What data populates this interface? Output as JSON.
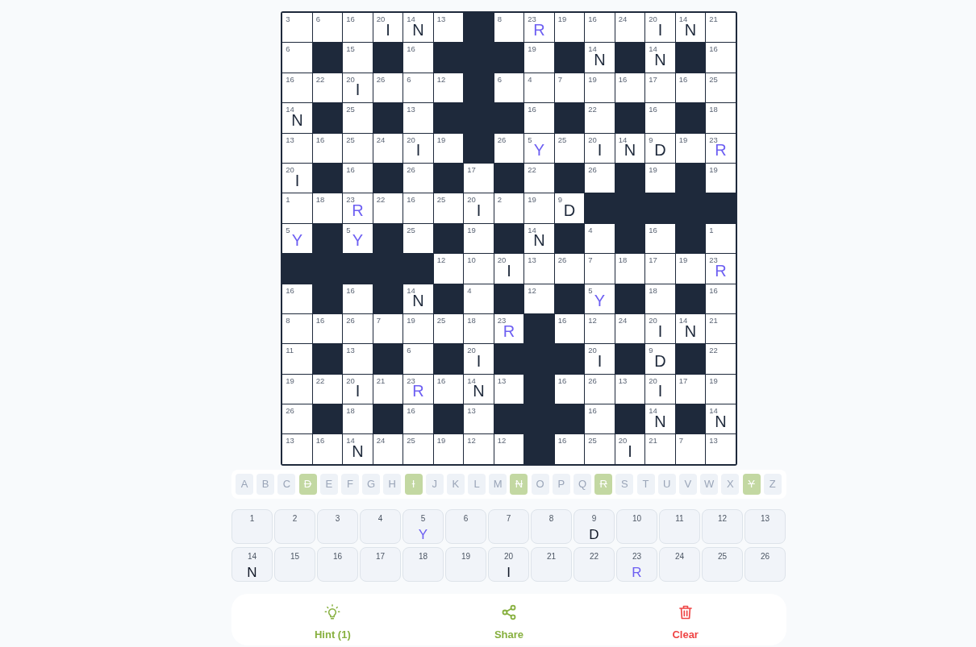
{
  "grid": {
    "rows": [
      [
        {
          "kind": "cell",
          "number": "3"
        },
        {
          "kind": "cell",
          "number": "6"
        },
        {
          "kind": "cell",
          "number": "16"
        },
        {
          "kind": "cell",
          "number": "20",
          "letter": "I",
          "given": false
        },
        {
          "kind": "cell",
          "number": "14",
          "letter": "N",
          "given": false
        },
        {
          "kind": "cell",
          "number": "13"
        },
        {
          "kind": "block"
        },
        {
          "kind": "cell",
          "number": "8"
        },
        {
          "kind": "cell",
          "number": "23",
          "letter": "R",
          "given": true
        },
        {
          "kind": "cell",
          "number": "19"
        },
        {
          "kind": "cell",
          "number": "16"
        },
        {
          "kind": "cell",
          "number": "24"
        },
        {
          "kind": "cell",
          "number": "20",
          "letter": "I",
          "given": false
        },
        {
          "kind": "cell",
          "number": "14",
          "letter": "N",
          "given": false
        },
        {
          "kind": "cell",
          "number": "21"
        }
      ],
      [
        {
          "kind": "cell",
          "number": "6"
        },
        {
          "kind": "block"
        },
        {
          "kind": "cell",
          "number": "15"
        },
        {
          "kind": "block"
        },
        {
          "kind": "cell",
          "number": "16"
        },
        {
          "kind": "block"
        },
        {
          "kind": "block"
        },
        {
          "kind": "block"
        },
        {
          "kind": "cell",
          "number": "19"
        },
        {
          "kind": "block"
        },
        {
          "kind": "cell",
          "number": "14",
          "letter": "N",
          "given": false
        },
        {
          "kind": "block"
        },
        {
          "kind": "cell",
          "number": "14",
          "letter": "N",
          "given": false
        },
        {
          "kind": "block"
        },
        {
          "kind": "cell",
          "number": "16"
        }
      ],
      [
        {
          "kind": "cell",
          "number": "16"
        },
        {
          "kind": "cell",
          "number": "22"
        },
        {
          "kind": "cell",
          "number": "20",
          "letter": "I",
          "given": false
        },
        {
          "kind": "cell",
          "number": "26"
        },
        {
          "kind": "cell",
          "number": "6"
        },
        {
          "kind": "cell",
          "number": "12"
        },
        {
          "kind": "block"
        },
        {
          "kind": "cell",
          "number": "6"
        },
        {
          "kind": "cell",
          "number": "4"
        },
        {
          "kind": "cell",
          "number": "7"
        },
        {
          "kind": "cell",
          "number": "19"
        },
        {
          "kind": "cell",
          "number": "16"
        },
        {
          "kind": "cell",
          "number": "17"
        },
        {
          "kind": "cell",
          "number": "16"
        },
        {
          "kind": "cell",
          "number": "25"
        }
      ],
      [
        {
          "kind": "cell",
          "number": "14",
          "letter": "N",
          "given": false
        },
        {
          "kind": "block"
        },
        {
          "kind": "cell",
          "number": "25"
        },
        {
          "kind": "block"
        },
        {
          "kind": "cell",
          "number": "13"
        },
        {
          "kind": "block"
        },
        {
          "kind": "block"
        },
        {
          "kind": "block"
        },
        {
          "kind": "cell",
          "number": "16"
        },
        {
          "kind": "block"
        },
        {
          "kind": "cell",
          "number": "22"
        },
        {
          "kind": "block"
        },
        {
          "kind": "cell",
          "number": "16"
        },
        {
          "kind": "block"
        },
        {
          "kind": "cell",
          "number": "18"
        }
      ],
      [
        {
          "kind": "cell",
          "number": "13"
        },
        {
          "kind": "cell",
          "number": "16"
        },
        {
          "kind": "cell",
          "number": "25"
        },
        {
          "kind": "cell",
          "number": "24"
        },
        {
          "kind": "cell",
          "number": "20",
          "letter": "I",
          "given": false
        },
        {
          "kind": "cell",
          "number": "19"
        },
        {
          "kind": "block"
        },
        {
          "kind": "cell",
          "number": "26"
        },
        {
          "kind": "cell",
          "number": "5",
          "letter": "Y",
          "given": true
        },
        {
          "kind": "cell",
          "number": "25"
        },
        {
          "kind": "cell",
          "number": "20",
          "letter": "I",
          "given": false
        },
        {
          "kind": "cell",
          "number": "14",
          "letter": "N",
          "given": false
        },
        {
          "kind": "cell",
          "number": "9",
          "letter": "D",
          "given": false
        },
        {
          "kind": "cell",
          "number": "19"
        },
        {
          "kind": "cell",
          "number": "23",
          "letter": "R",
          "given": true
        }
      ],
      [
        {
          "kind": "cell",
          "number": "20",
          "letter": "I",
          "given": false
        },
        {
          "kind": "block"
        },
        {
          "kind": "cell",
          "number": "16"
        },
        {
          "kind": "block"
        },
        {
          "kind": "cell",
          "number": "26"
        },
        {
          "kind": "block"
        },
        {
          "kind": "cell",
          "number": "17"
        },
        {
          "kind": "block"
        },
        {
          "kind": "cell",
          "number": "22"
        },
        {
          "kind": "block"
        },
        {
          "kind": "cell",
          "number": "26"
        },
        {
          "kind": "block"
        },
        {
          "kind": "cell",
          "number": "19"
        },
        {
          "kind": "block"
        },
        {
          "kind": "cell",
          "number": "19"
        }
      ],
      [
        {
          "kind": "cell",
          "number": "1"
        },
        {
          "kind": "cell",
          "number": "18"
        },
        {
          "kind": "cell",
          "number": "23",
          "letter": "R",
          "given": true
        },
        {
          "kind": "cell",
          "number": "22"
        },
        {
          "kind": "cell",
          "number": "16"
        },
        {
          "kind": "cell",
          "number": "25"
        },
        {
          "kind": "cell",
          "number": "20",
          "letter": "I",
          "given": false
        },
        {
          "kind": "cell",
          "number": "2"
        },
        {
          "kind": "cell",
          "number": "19"
        },
        {
          "kind": "cell",
          "number": "9",
          "letter": "D",
          "given": false
        },
        {
          "kind": "block"
        },
        {
          "kind": "block"
        },
        {
          "kind": "block"
        },
        {
          "kind": "block"
        },
        {
          "kind": "block"
        }
      ],
      [
        {
          "kind": "cell",
          "number": "5",
          "letter": "Y",
          "given": true
        },
        {
          "kind": "block"
        },
        {
          "kind": "cell",
          "number": "5",
          "letter": "Y",
          "given": true
        },
        {
          "kind": "block"
        },
        {
          "kind": "cell",
          "number": "25"
        },
        {
          "kind": "block"
        },
        {
          "kind": "cell",
          "number": "19"
        },
        {
          "kind": "block"
        },
        {
          "kind": "cell",
          "number": "14",
          "letter": "N",
          "given": false
        },
        {
          "kind": "block"
        },
        {
          "kind": "cell",
          "number": "4"
        },
        {
          "kind": "block"
        },
        {
          "kind": "cell",
          "number": "16"
        },
        {
          "kind": "block"
        },
        {
          "kind": "cell",
          "number": "1"
        }
      ],
      [
        {
          "kind": "block"
        },
        {
          "kind": "block"
        },
        {
          "kind": "block"
        },
        {
          "kind": "block"
        },
        {
          "kind": "block"
        },
        {
          "kind": "cell",
          "number": "12"
        },
        {
          "kind": "cell",
          "number": "10"
        },
        {
          "kind": "cell",
          "number": "20",
          "letter": "I",
          "given": false
        },
        {
          "kind": "cell",
          "number": "13"
        },
        {
          "kind": "cell",
          "number": "26"
        },
        {
          "kind": "cell",
          "number": "7"
        },
        {
          "kind": "cell",
          "number": "18"
        },
        {
          "kind": "cell",
          "number": "17"
        },
        {
          "kind": "cell",
          "number": "19"
        },
        {
          "kind": "cell",
          "number": "23",
          "letter": "R",
          "given": true
        }
      ],
      [
        {
          "kind": "cell",
          "number": "16"
        },
        {
          "kind": "block"
        },
        {
          "kind": "cell",
          "number": "16"
        },
        {
          "kind": "block"
        },
        {
          "kind": "cell",
          "number": "14",
          "letter": "N",
          "given": false
        },
        {
          "kind": "block"
        },
        {
          "kind": "cell",
          "number": "4"
        },
        {
          "kind": "block"
        },
        {
          "kind": "cell",
          "number": "12"
        },
        {
          "kind": "block"
        },
        {
          "kind": "cell",
          "number": "5",
          "letter": "Y",
          "given": true
        },
        {
          "kind": "block"
        },
        {
          "kind": "cell",
          "number": "18"
        },
        {
          "kind": "block"
        },
        {
          "kind": "cell",
          "number": "16"
        }
      ],
      [
        {
          "kind": "cell",
          "number": "8"
        },
        {
          "kind": "cell",
          "number": "16"
        },
        {
          "kind": "cell",
          "number": "26"
        },
        {
          "kind": "cell",
          "number": "7"
        },
        {
          "kind": "cell",
          "number": "19"
        },
        {
          "kind": "cell",
          "number": "25"
        },
        {
          "kind": "cell",
          "number": "18"
        },
        {
          "kind": "cell",
          "number": "23",
          "letter": "R",
          "given": true
        },
        {
          "kind": "block"
        },
        {
          "kind": "cell",
          "number": "16"
        },
        {
          "kind": "cell",
          "number": "12"
        },
        {
          "kind": "cell",
          "number": "24"
        },
        {
          "kind": "cell",
          "number": "20",
          "letter": "I",
          "given": false
        },
        {
          "kind": "cell",
          "number": "14",
          "letter": "N",
          "given": false
        },
        {
          "kind": "cell",
          "number": "21"
        }
      ],
      [
        {
          "kind": "cell",
          "number": "11"
        },
        {
          "kind": "block"
        },
        {
          "kind": "cell",
          "number": "13"
        },
        {
          "kind": "block"
        },
        {
          "kind": "cell",
          "number": "6"
        },
        {
          "kind": "block"
        },
        {
          "kind": "cell",
          "number": "20",
          "letter": "I",
          "given": false
        },
        {
          "kind": "block"
        },
        {
          "kind": "block"
        },
        {
          "kind": "block"
        },
        {
          "kind": "cell",
          "number": "20",
          "letter": "I",
          "given": false
        },
        {
          "kind": "block"
        },
        {
          "kind": "cell",
          "number": "9",
          "letter": "D",
          "given": false
        },
        {
          "kind": "block"
        },
        {
          "kind": "cell",
          "number": "22"
        }
      ],
      [
        {
          "kind": "cell",
          "number": "19"
        },
        {
          "kind": "cell",
          "number": "22"
        },
        {
          "kind": "cell",
          "number": "20",
          "letter": "I",
          "given": false
        },
        {
          "kind": "cell",
          "number": "21"
        },
        {
          "kind": "cell",
          "number": "23",
          "letter": "R",
          "given": true
        },
        {
          "kind": "cell",
          "number": "16"
        },
        {
          "kind": "cell",
          "number": "14",
          "letter": "N",
          "given": false
        },
        {
          "kind": "cell",
          "number": "13"
        },
        {
          "kind": "block"
        },
        {
          "kind": "cell",
          "number": "16"
        },
        {
          "kind": "cell",
          "number": "26"
        },
        {
          "kind": "cell",
          "number": "13"
        },
        {
          "kind": "cell",
          "number": "20",
          "letter": "I",
          "given": false
        },
        {
          "kind": "cell",
          "number": "17"
        },
        {
          "kind": "cell",
          "number": "19"
        }
      ],
      [
        {
          "kind": "cell",
          "number": "26"
        },
        {
          "kind": "block"
        },
        {
          "kind": "cell",
          "number": "18"
        },
        {
          "kind": "block"
        },
        {
          "kind": "cell",
          "number": "16"
        },
        {
          "kind": "block"
        },
        {
          "kind": "cell",
          "number": "13"
        },
        {
          "kind": "block"
        },
        {
          "kind": "block"
        },
        {
          "kind": "block"
        },
        {
          "kind": "cell",
          "number": "16"
        },
        {
          "kind": "block"
        },
        {
          "kind": "cell",
          "number": "14",
          "letter": "N",
          "given": false
        },
        {
          "kind": "block"
        },
        {
          "kind": "cell",
          "number": "14",
          "letter": "N",
          "given": false
        }
      ],
      [
        {
          "kind": "cell",
          "number": "13"
        },
        {
          "kind": "cell",
          "number": "16"
        },
        {
          "kind": "cell",
          "number": "14",
          "letter": "N",
          "given": false
        },
        {
          "kind": "cell",
          "number": "24"
        },
        {
          "kind": "cell",
          "number": "25"
        },
        {
          "kind": "cell",
          "number": "19"
        },
        {
          "kind": "cell",
          "number": "12"
        },
        {
          "kind": "cell",
          "number": "12"
        },
        {
          "kind": "block"
        },
        {
          "kind": "cell",
          "number": "16"
        },
        {
          "kind": "cell",
          "number": "25"
        },
        {
          "kind": "cell",
          "number": "20",
          "letter": "I",
          "given": false
        },
        {
          "kind": "cell",
          "number": "21"
        },
        {
          "kind": "cell",
          "number": "7"
        },
        {
          "kind": "cell",
          "number": "13"
        }
      ]
    ]
  },
  "alphabet": [
    {
      "letter": "A",
      "used": false
    },
    {
      "letter": "B",
      "used": false
    },
    {
      "letter": "C",
      "used": false
    },
    {
      "letter": "D",
      "used": true
    },
    {
      "letter": "E",
      "used": false
    },
    {
      "letter": "F",
      "used": false
    },
    {
      "letter": "G",
      "used": false
    },
    {
      "letter": "H",
      "used": false
    },
    {
      "letter": "I",
      "used": true
    },
    {
      "letter": "J",
      "used": false
    },
    {
      "letter": "K",
      "used": false
    },
    {
      "letter": "L",
      "used": false
    },
    {
      "letter": "M",
      "used": false
    },
    {
      "letter": "N",
      "used": true
    },
    {
      "letter": "O",
      "used": false
    },
    {
      "letter": "P",
      "used": false
    },
    {
      "letter": "Q",
      "used": false
    },
    {
      "letter": "R",
      "used": true
    },
    {
      "letter": "S",
      "used": false
    },
    {
      "letter": "T",
      "used": false
    },
    {
      "letter": "U",
      "used": false
    },
    {
      "letter": "V",
      "used": false
    },
    {
      "letter": "W",
      "used": false
    },
    {
      "letter": "X",
      "used": false
    },
    {
      "letter": "Y",
      "used": true
    },
    {
      "letter": "Z",
      "used": false
    }
  ],
  "key": [
    {
      "number": "1"
    },
    {
      "number": "2"
    },
    {
      "number": "3"
    },
    {
      "number": "4"
    },
    {
      "number": "5",
      "letter": "Y",
      "given": true
    },
    {
      "number": "6"
    },
    {
      "number": "7"
    },
    {
      "number": "8"
    },
    {
      "number": "9",
      "letter": "D",
      "given": false
    },
    {
      "number": "10"
    },
    {
      "number": "11"
    },
    {
      "number": "12"
    },
    {
      "number": "13"
    },
    {
      "number": "14",
      "letter": "N",
      "given": false
    },
    {
      "number": "15"
    },
    {
      "number": "16"
    },
    {
      "number": "17"
    },
    {
      "number": "18"
    },
    {
      "number": "19"
    },
    {
      "number": "20",
      "letter": "I",
      "given": false
    },
    {
      "number": "21"
    },
    {
      "number": "22"
    },
    {
      "number": "23",
      "letter": "R",
      "given": true
    },
    {
      "number": "24"
    },
    {
      "number": "25"
    },
    {
      "number": "26"
    }
  ],
  "actions": [
    {
      "kind": "hint",
      "label": "Hint (1)"
    },
    {
      "kind": "share",
      "label": "Share"
    },
    {
      "kind": "clear",
      "label": "Clear"
    }
  ]
}
